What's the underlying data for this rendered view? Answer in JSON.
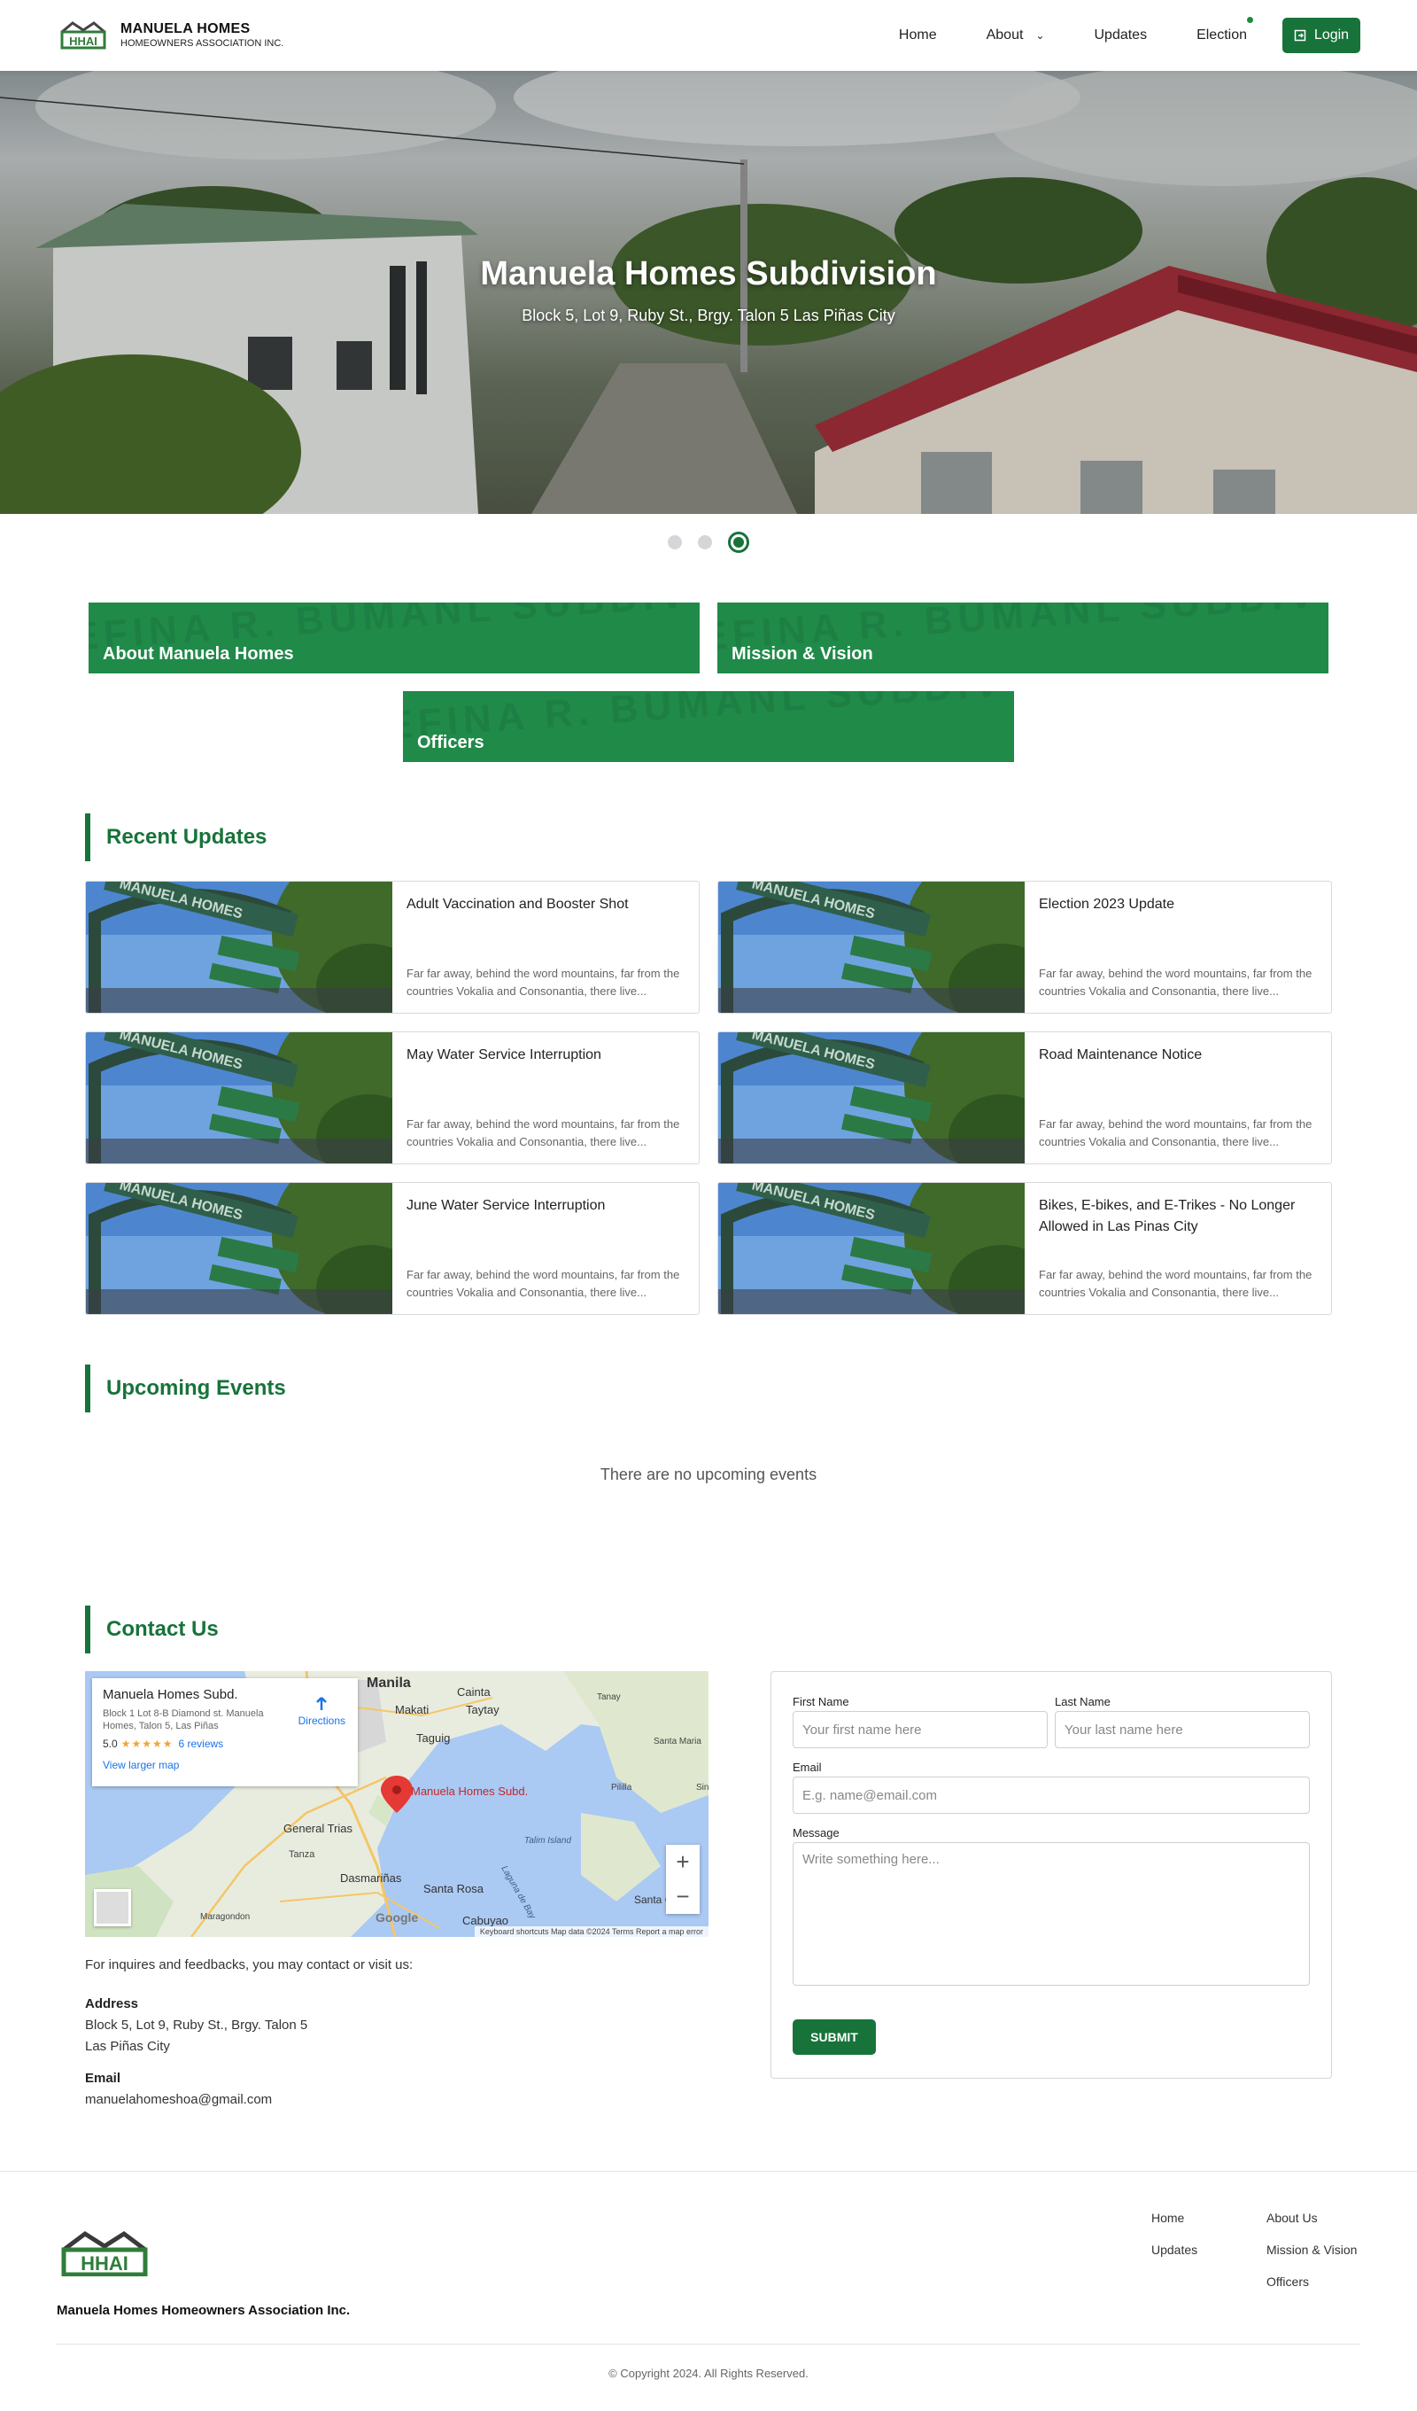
{
  "nav": {
    "brand_name": "MANUELA HOMES",
    "brand_sub": "HOMEOWNERS ASSOCIATION INC.",
    "logo_text": "HHAI",
    "links": [
      "Home",
      "About",
      "Updates",
      "Election"
    ],
    "login": "Login"
  },
  "hero": {
    "title": "Manuela Homes Subdivision",
    "subtitle": "Block 5, Lot 9, Ruby St., Brgy. Talon 5 Las Piñas City",
    "slides": 3,
    "active_slide": 3
  },
  "tiles": [
    "About Manuela Homes",
    "Mission & Vision",
    "Officers"
  ],
  "updates": {
    "title": "Recent Updates",
    "excerpt": "Far far away, behind the word mountains, far from the countries Vokalia and Consonantia, there live...",
    "items": [
      "Adult Vaccination and Booster Shot",
      "Election 2023 Update",
      "May Water Service Interruption",
      "Road Maintenance Notice",
      "June Water Service Interruption",
      "Bikes, E-bikes, and E-Trikes - No Longer Allowed in Las Pinas City"
    ]
  },
  "events": {
    "title": "Upcoming Events",
    "empty": "There are no upcoming events"
  },
  "contact": {
    "title": "Contact Us",
    "map": {
      "place": "Manuela Homes Subd.",
      "address": "Block 1 Lot 8-B Diamond st. Manuela Homes, Talon 5, Las Piñas",
      "rating": "5.0",
      "stars": "★★★★★",
      "reviews": "6 reviews",
      "larger": "View larger map",
      "directions": "Directions",
      "pin_label": "Manuela Homes Subd.",
      "attribution": "Keyboard shortcuts   Map data ©2024   Terms   Report a map error",
      "google": "Google",
      "labels": [
        "Manila",
        "Makati",
        "Cainta",
        "Taytay",
        "Taguig",
        "Tanay",
        "Santa Maria",
        "Pililla",
        "Siniloan",
        "General Trias",
        "Tanza",
        "Dasmariñas",
        "Santa Rosa",
        "Cabuyao",
        "Maragondon",
        "Talim Island",
        "Laguna de Bay",
        "Santa Cruz"
      ]
    },
    "intro": "For inquires and feedbacks, you may contact or visit us:",
    "address_label": "Address",
    "address_1": "Block 5, Lot 9, Ruby St., Brgy. Talon 5",
    "address_2": "Las Piñas City",
    "email_label": "Email",
    "email": "manuelahomeshoa@gmail.com"
  },
  "form": {
    "first_label": "First Name",
    "first_ph": "Your first name here",
    "last_label": "Last Name",
    "last_ph": "Your last name here",
    "email_label": "Email",
    "email_ph": "E.g. name@email.com",
    "msg_label": "Message",
    "msg_ph": "Write something here...",
    "submit": "SUBMIT"
  },
  "footer": {
    "org": "Manuela Homes Homeowners Association Inc.",
    "col1": [
      "Home",
      "Updates"
    ],
    "col2": [
      "About Us",
      "Mission & Vision",
      "Officers"
    ],
    "copyright": "© Copyright 2024. All Rights Reserved."
  },
  "colors": {
    "brand_green": "#17733a",
    "tile_green": "#208a49"
  }
}
